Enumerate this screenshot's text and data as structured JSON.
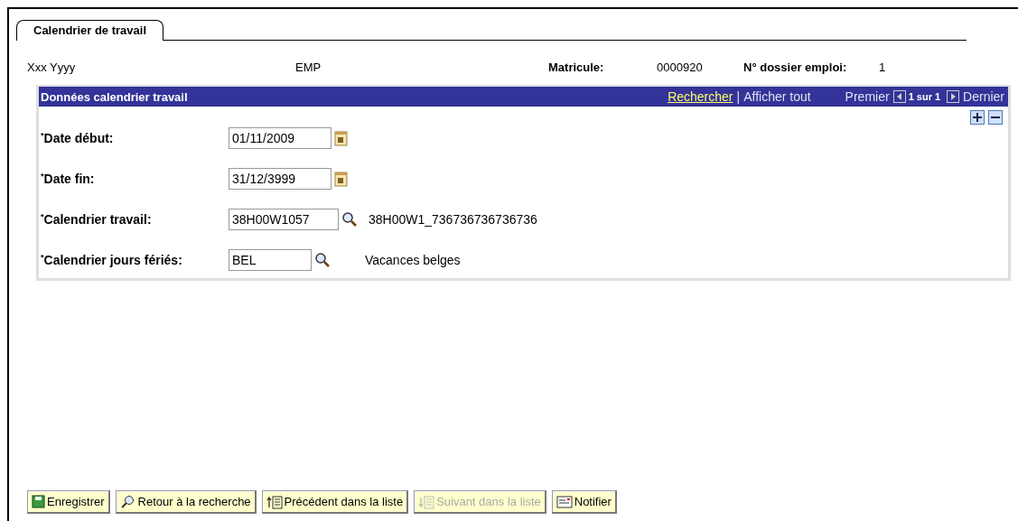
{
  "tab": {
    "label": "Calendrier de travail",
    "selected": true
  },
  "employee": {
    "name": "Xxx Yyyy",
    "type": "EMP",
    "id_label": "Matricule:",
    "id_value": "0000920",
    "record_label": "N° dossier emploi:",
    "record_value": "1"
  },
  "panel": {
    "title": "Données calendrier travail",
    "search_link": "Rechercher",
    "separator": "|",
    "show_all": "Afficher tout",
    "first": "Premier",
    "counter": "1 sur 1",
    "last": "Dernier",
    "fields": [
      {
        "required_mark": "*",
        "label": "Date début:",
        "value": "01/11/2009",
        "kind": "date"
      },
      {
        "required_mark": "*",
        "label": "Date fin:",
        "value": "31/12/3999",
        "kind": "date"
      },
      {
        "required_mark": "*",
        "label": "Calendrier travail:",
        "value": "38H00W1057",
        "kind": "lookup",
        "description": "38H00W1_736736736736736"
      },
      {
        "required_mark": "*",
        "label": "Calendrier jours fériés:",
        "value": "BEL",
        "kind": "lookup",
        "description": "Vacances belges"
      }
    ]
  },
  "buttons": [
    {
      "label": "Enregistrer",
      "kind": "save",
      "disabled": false
    },
    {
      "label": "Retour à la recherche",
      "kind": "search",
      "disabled": false
    },
    {
      "label": "Précédent dans la liste",
      "kind": "previous",
      "disabled": false
    },
    {
      "label": "Suivant dans la liste",
      "kind": "next",
      "disabled": true
    },
    {
      "label": "Notifier",
      "kind": "notify",
      "disabled": false
    }
  ]
}
